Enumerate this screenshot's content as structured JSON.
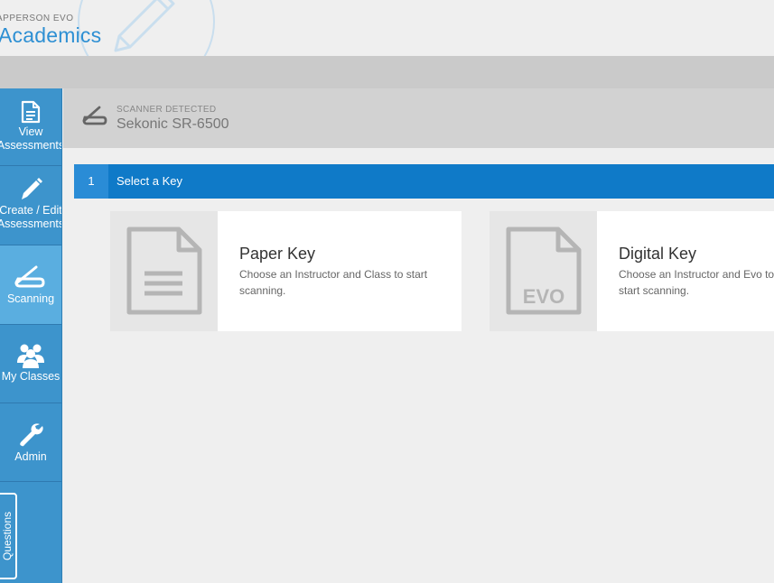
{
  "header": {
    "brand_small": "APPERSON EVO",
    "brand_big": "Academics"
  },
  "sidebar": {
    "items": [
      {
        "label_line1": "View",
        "label_line2": "Assessments"
      },
      {
        "label_line1": "Create / Edit",
        "label_line2": "Assessments"
      },
      {
        "label": "Scanning"
      },
      {
        "label": "My Classes"
      },
      {
        "label": "Admin"
      }
    ],
    "questions_tab": "Questions"
  },
  "scanner": {
    "label": "SCANNER DETECTED",
    "name": "Sekonic SR-6500"
  },
  "step": {
    "number": "1",
    "title": "Select a Key"
  },
  "cards": {
    "paper": {
      "title": "Paper Key",
      "description": "Choose an Instructor and Class to start scanning."
    },
    "digital": {
      "title": "Digital Key",
      "description": "Choose an Instructor and Evo to start scanning.",
      "icon_text": "EVO"
    }
  }
}
